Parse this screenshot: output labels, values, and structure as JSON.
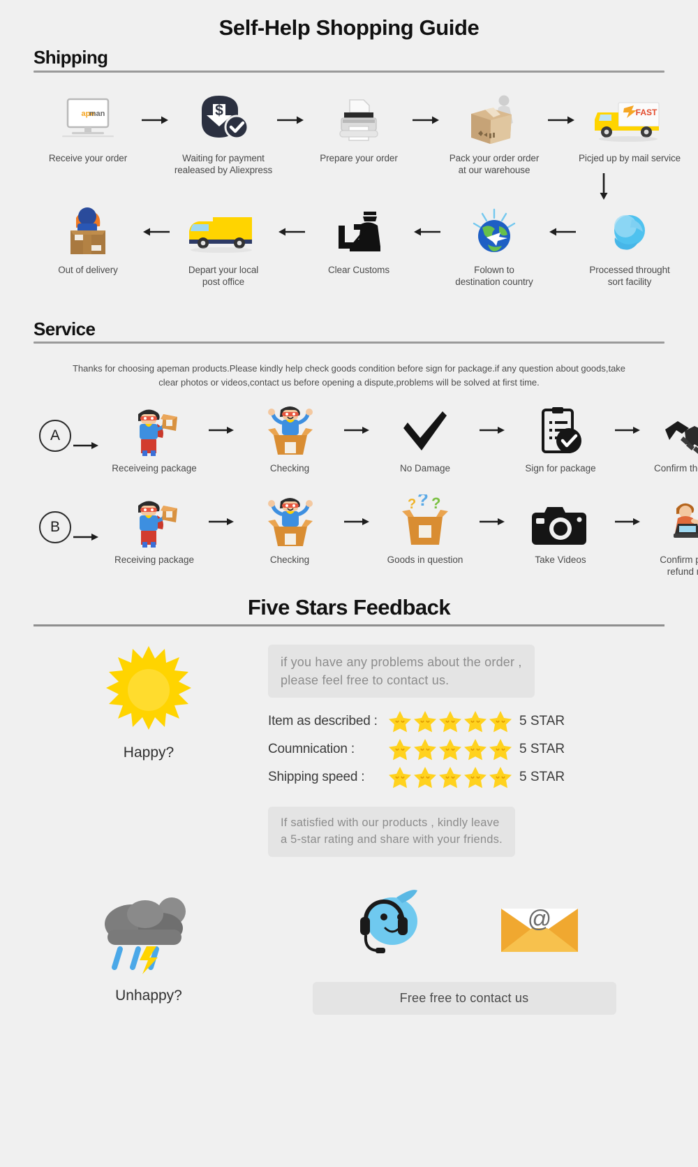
{
  "title": "Self-Help Shopping Guide",
  "shipping": {
    "heading": "Shipping",
    "row1": [
      {
        "icon": "monitor-apeman-icon",
        "label": "Receive your order"
      },
      {
        "icon": "payment-dollar-shield-icon",
        "label": "Waiting for payment\nrealeased by Aliexpress"
      },
      {
        "icon": "printer-icon",
        "label": "Prepare your order"
      },
      {
        "icon": "packing-box-worker-icon",
        "label": "Pack your order order\nat our warehouse"
      },
      {
        "icon": "yellow-fast-truck-icon",
        "label": "Picjed up by mail service"
      }
    ],
    "row2": [
      {
        "icon": "out-for-delivery-courier-icon",
        "label": "Out of delivery"
      },
      {
        "icon": "yellow-delivery-van-icon",
        "label": "Depart your local\npost office"
      },
      {
        "icon": "customs-officer-icon",
        "label": "Clear Customs"
      },
      {
        "icon": "globe-airplane-icon",
        "label": "Folown to\ndestination country"
      },
      {
        "icon": "blue-globe-sort-icon",
        "label": "Processed throught\nsort facility"
      }
    ]
  },
  "service": {
    "heading": "Service",
    "note": "Thanks for choosing apeman products.Please kindly help check goods condition before sign for package.if any question about goods,take clear photos or videos,contact us before opening a dispute,problems will be solved at first time.",
    "rowA": {
      "badge": "A",
      "steps": [
        {
          "icon": "superhero-package-icon",
          "label": "Receiveing package"
        },
        {
          "icon": "open-box-happy-icon",
          "label": "Checking"
        },
        {
          "icon": "checkmark-icon",
          "label": "No Damage"
        },
        {
          "icon": "clipboard-check-icon",
          "label": "Sign for package"
        },
        {
          "icon": "handshake-icon",
          "label": "Confirm the delivery"
        }
      ]
    },
    "rowB": {
      "badge": "B",
      "steps": [
        {
          "icon": "superhero-package-icon",
          "label": "Receiving package"
        },
        {
          "icon": "open-box-happy-icon",
          "label": "Checking"
        },
        {
          "icon": "question-box-icon",
          "label": "Goods in question"
        },
        {
          "icon": "camera-icon",
          "label": "Take Videos"
        },
        {
          "icon": "refund-dollar-person-icon",
          "label": "Confirm problem,\nrefund money"
        }
      ]
    }
  },
  "feedback": {
    "title": "Five Stars Feedback",
    "bubble_top": "if you have any problems about the order ,\nplease feel free to contact us.",
    "bubble_bottom": "If satisfied with our products , kindly leave\na 5-star rating and share with your friends.",
    "happy_label": "Happy?",
    "unhappy_label": "Unhappy?",
    "contact_button": "Free free to contact us",
    "ratings": [
      {
        "label": "Item as described :",
        "stars": 5,
        "value": "5 STAR"
      },
      {
        "label": "Coumnication :",
        "stars": 5,
        "value": "5 STAR"
      },
      {
        "label": "Shipping speed :",
        "stars": 5,
        "value": "5 STAR"
      }
    ],
    "icons": {
      "happy": "sun-icon",
      "unhappy": "rain-cloud-icon",
      "support": "headset-support-icon",
      "email": "email-envelope-icon"
    }
  },
  "colors": {
    "background": "#f0f0f0",
    "star": "#ffd21e",
    "truck": "#ffd400",
    "accent_orange": "#f5a623",
    "text": "#3a3a3a"
  }
}
